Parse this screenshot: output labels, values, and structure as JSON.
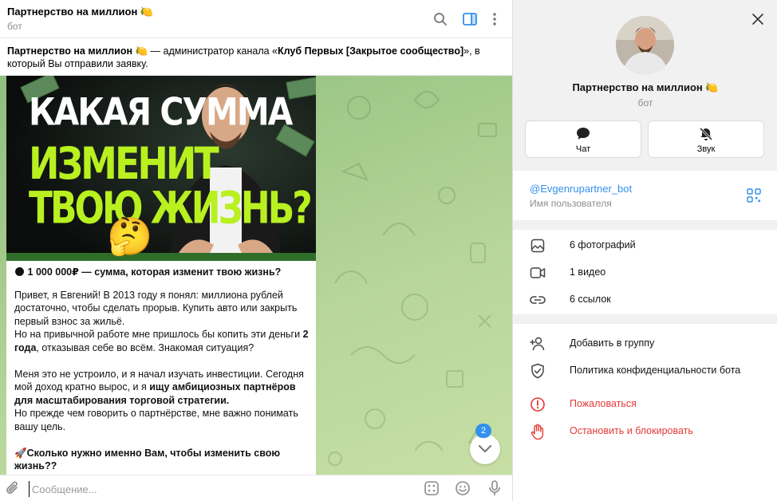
{
  "chat": {
    "title": "Партнерство на миллион 🍋",
    "subtitle": "бот",
    "pinned": {
      "name": "Партнерство на миллион 🍋",
      "text_mid": " — администратор канала «",
      "channel": "Клуб Первых [Закрытое сообщество]",
      "text_end": "», в который Вы отправили заявку."
    },
    "promo_image": {
      "line1": "КАКАЯ СУММА",
      "line2": "ИЗМЕНИТ",
      "line3": "ТВОЮ ЖИЗНЬ?",
      "emoji": "🤔"
    },
    "message": {
      "heading": "1 000 000₽ — сумма, которая изменит твою жизнь?",
      "heading_icon": "🌑",
      "p1": "Привет, я Евгений! В 2013 году я понял: миллиона рублей достаточно, чтобы сделать прорыв. Купить авто или закрыть первый взнос за жильё.",
      "p2_a": "Но на привычной работе мне пришлось бы копить эти деньги ",
      "p2_b": "2 года",
      "p2_c": ", отказывая себе во всём. Знакомая ситуация?",
      "p3_a": "Меня это не устроило, и я начал изучать инвестиции.  Сегодня мой доход кратно вырос, и я ",
      "p3_b": "ищу амбициозных партнёров для масштабирования торговой стратегии.",
      "p4": "Но прежде чем говорить о партнёрстве, мне важно понимать вашу цель.",
      "question": "Сколько нужно именно Вам, чтобы изменить свою жизнь??",
      "question_icon": "🚀"
    },
    "unread_count": "2",
    "composer_placeholder": "Сообщение..."
  },
  "panel": {
    "name": "Партнерство на миллион 🍋",
    "subtitle": "бот",
    "chat_button": "Чат",
    "sound_button": "Звук",
    "username": "@Evgenrupartner_bot",
    "username_label": "Имя пользователя",
    "media": [
      {
        "icon": "photo-icon",
        "label": "6 фотографий"
      },
      {
        "icon": "video-icon",
        "label": "1 видео"
      },
      {
        "icon": "link-icon",
        "label": "6 ссылок"
      }
    ],
    "actions": {
      "add_to_group": "Добавить в группу",
      "privacy": "Политика конфиденциальности бота",
      "report": "Пожаловаться",
      "block": "Остановить и блокировать"
    }
  },
  "colors": {
    "accent": "#3390ec",
    "danger": "#e53935",
    "promo_green": "#b8f020"
  }
}
